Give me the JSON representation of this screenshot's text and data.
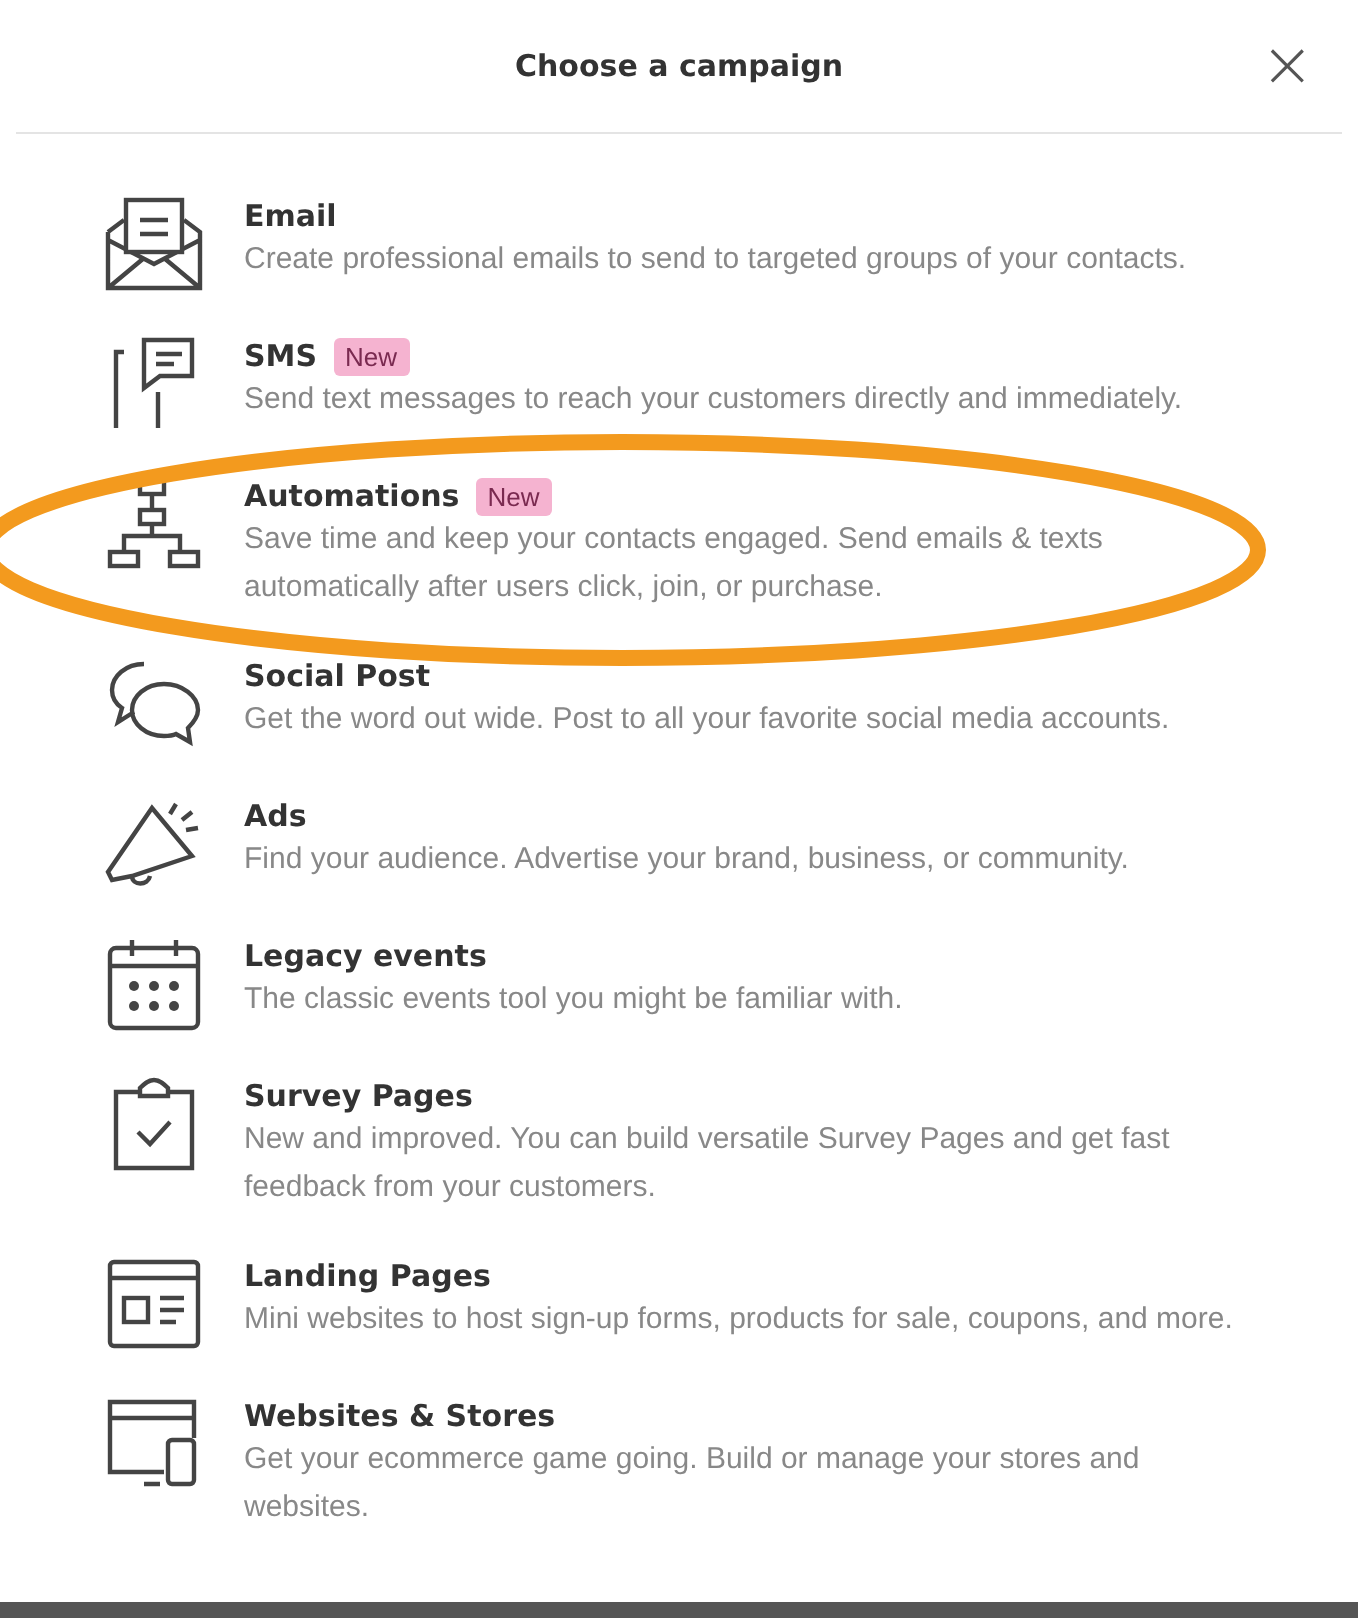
{
  "dialog": {
    "title": "Choose a campaign",
    "close": "×"
  },
  "items": [
    {
      "kind": "email",
      "title": "Email",
      "description": "Create professional emails to send to targeted groups of your contacts.",
      "highlighted": false
    },
    {
      "kind": "sms",
      "title": "SMS",
      "badge": "New",
      "description": "Send text messages to reach your customers directly and immediately.",
      "highlighted": false
    },
    {
      "kind": "automations",
      "title": "Automations",
      "badge": "New",
      "description": "Save time and keep your contacts engaged. Send emails & texts automatically after users click, join, or purchase.",
      "highlighted": true
    },
    {
      "kind": "social",
      "title": "Social Post",
      "description": "Get the word out wide. Post to all your favorite social media accounts.",
      "highlighted": false
    },
    {
      "kind": "ads",
      "title": "Ads",
      "description": "Find your audience. Advertise your brand, business, or community.",
      "highlighted": false
    },
    {
      "kind": "events",
      "title": "Legacy events",
      "description": "The classic events tool you might be familiar with.",
      "highlighted": false
    },
    {
      "kind": "survey",
      "title": "Survey Pages",
      "description": "New and improved. You can build versatile Survey Pages and get fast feedback from your customers.",
      "highlighted": false
    },
    {
      "kind": "landing",
      "title": "Landing Pages",
      "description": "Mini websites to host sign-up forms, products for sale, coupons, and more.",
      "highlighted": false
    },
    {
      "kind": "websites",
      "title": "Websites & Stores",
      "description": "Get your ecommerce game going. Build or manage your stores and websites.",
      "highlighted": false
    }
  ]
}
